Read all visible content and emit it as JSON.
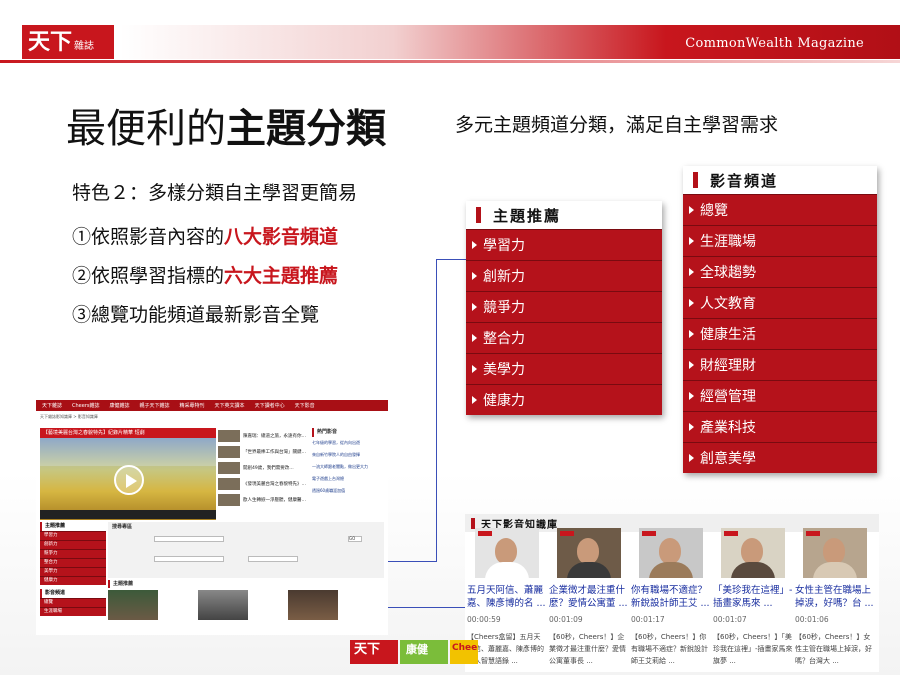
{
  "header": {
    "logo_text": "天下",
    "logo_sub": "雜誌",
    "magazine_name": "CommonWealth Magazine"
  },
  "title": {
    "regular": "最便利的",
    "bold": "主題分類",
    "subtitle": "多元主題頻道分類，滿足自主學習需求"
  },
  "features": {
    "heading": "特色２：多樣分類自主學習更簡易",
    "f1_prefix": "①依照影音內容的",
    "f1_highlight": "八大影音頻道",
    "f2_prefix": "②依照學習指標的",
    "f2_highlight": "六大主題推薦",
    "f3": "③總覽功能頻道最新影音全覽"
  },
  "topic_panel": {
    "title": "主題推薦",
    "items": [
      "學習力",
      "創新力",
      "競爭力",
      "整合力",
      "美學力",
      "健康力"
    ]
  },
  "channel_panel": {
    "title": "影音頻道",
    "items": [
      "總覽",
      "生涯職場",
      "全球趨勢",
      "人文教育",
      "健康生活",
      "財經理財",
      "經營管理",
      "產業科技",
      "創意美學"
    ]
  },
  "site": {
    "nav": [
      "天下雜誌",
      "Cheers雜誌",
      "康健雜誌",
      "親子天下雜誌",
      "精采專特刊",
      "天下英文讀本",
      "天下讀者中心",
      "天下影音"
    ],
    "crumb": "天下雜誌影知識庫 > 影音知識庫",
    "banner": "【藝境美麗台灣之春貌特先】紀錄片精華 短劇",
    "list": [
      "陳嘉瑞：總道之旅，永遠有你…",
      "「世界最棒工作與台灣」關鍵…",
      "開創49歲，我們需要改…",
      "《發現美麗台灣之春貌特先》…",
      "歐人生轉捩一淨壓聽，健康醫…"
    ],
    "hot_title": "熱門影音",
    "hot": [
      "七年級的學習，從內向出遊",
      "來自新竹學院人的自由發揮",
      "一流大師跟老闆點，做出更大力",
      "電子遊戲上台灣總",
      "透過60歲職涯加值"
    ],
    "side_title": "主題推薦",
    "side_items": [
      "學習力",
      "創新力",
      "競爭力",
      "整合力",
      "美學力",
      "健康力"
    ],
    "side_title2": "影音頻道",
    "side_items2": [
      "總覽",
      "生涯職場"
    ],
    "search_title": "搜尋專區",
    "search_go": "GO",
    "rec_title": "主題推薦",
    "more": "more"
  },
  "knowledge": {
    "title": "天下影音知識庫",
    "cards": [
      {
        "title": "五月天阿信、蕭麗嘉、陳彥博的名 ...",
        "time": "00:00:59",
        "desc": "【Cheers盒留】五月天阿信、蕭麗嘉、陳彥博的名人智慧語錄 ..."
      },
      {
        "title": "企業徵才最注重什麼？愛情公寓董 ...",
        "time": "00:01:09",
        "desc": "【60秒，Cheers！】企業徵才最注重什麼？愛情公寓董事長 ..."
      },
      {
        "title": "你有職場不適症？新銳設計師王艾 ...",
        "time": "00:01:17",
        "desc": "【60秒，Cheers！】你有職場不適症？新銳設計師王艾莉給 ..."
      },
      {
        "title": "「美珍我在這裡」-插畫家馬來 ...",
        "time": "00:01:07",
        "desc": "【60秒，Cheers！】「美珍我在這裡」-插畫家馬來旗夢 ..."
      },
      {
        "title": "女性主管在職場上掉淚，好嗎？台 ...",
        "time": "00:01:06",
        "desc": "【60秒，Cheers！】女性主管在職場上掉淚，好嗎？台灣大 ..."
      }
    ]
  },
  "footer": {
    "brand1": "天下",
    "brand2": "康健",
    "brand3": "Chee"
  }
}
